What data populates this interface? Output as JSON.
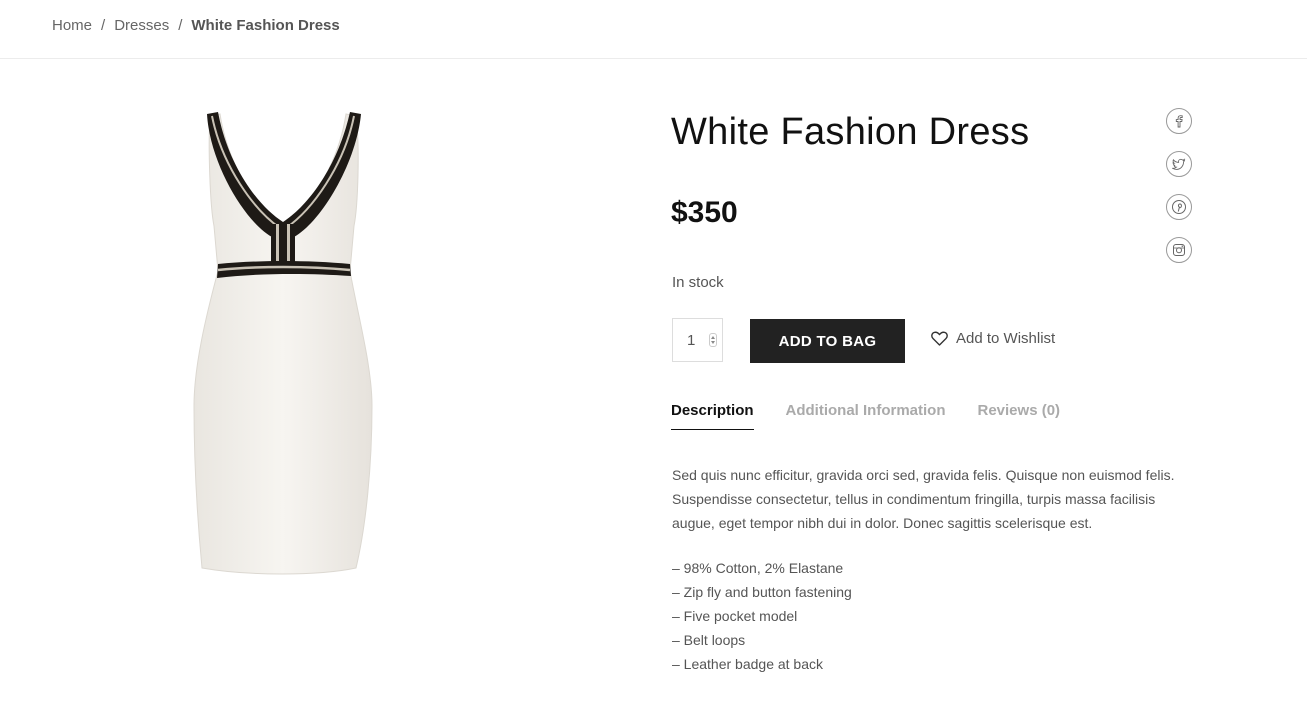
{
  "breadcrumb": {
    "home": "Home",
    "separator": "/",
    "category": "Dresses",
    "current": "White Fashion Dress"
  },
  "product": {
    "title": "White Fashion Dress",
    "price": "$350",
    "stock": "In stock",
    "quantity": "1",
    "add_to_bag": "ADD TO BAG",
    "wishlist": "Add to Wishlist"
  },
  "tabs": [
    {
      "label": "Description",
      "active": true
    },
    {
      "label": "Additional Information",
      "active": false
    },
    {
      "label": "Reviews (0)",
      "active": false
    }
  ],
  "description": "Sed quis nunc efficitur, gravida orci sed, gravida felis. Quisque non euismod felis. Suspendisse consectetur, tellus in condimentum fringilla, turpis massa facilisis augue, eget tempor nibh dui in dolor. Donec sagittis scelerisque est.",
  "features": [
    "– 98% Cotton, 2% Elastane",
    "– Zip fly and button fastening",
    "– Five pocket model",
    "– Belt loops",
    "– Leather badge at back"
  ],
  "social": [
    "facebook-icon",
    "twitter-icon",
    "pinterest-icon",
    "instagram-icon"
  ],
  "colors": {
    "dark": "#222222",
    "text": "#555555",
    "muted": "#aaaaaa"
  }
}
